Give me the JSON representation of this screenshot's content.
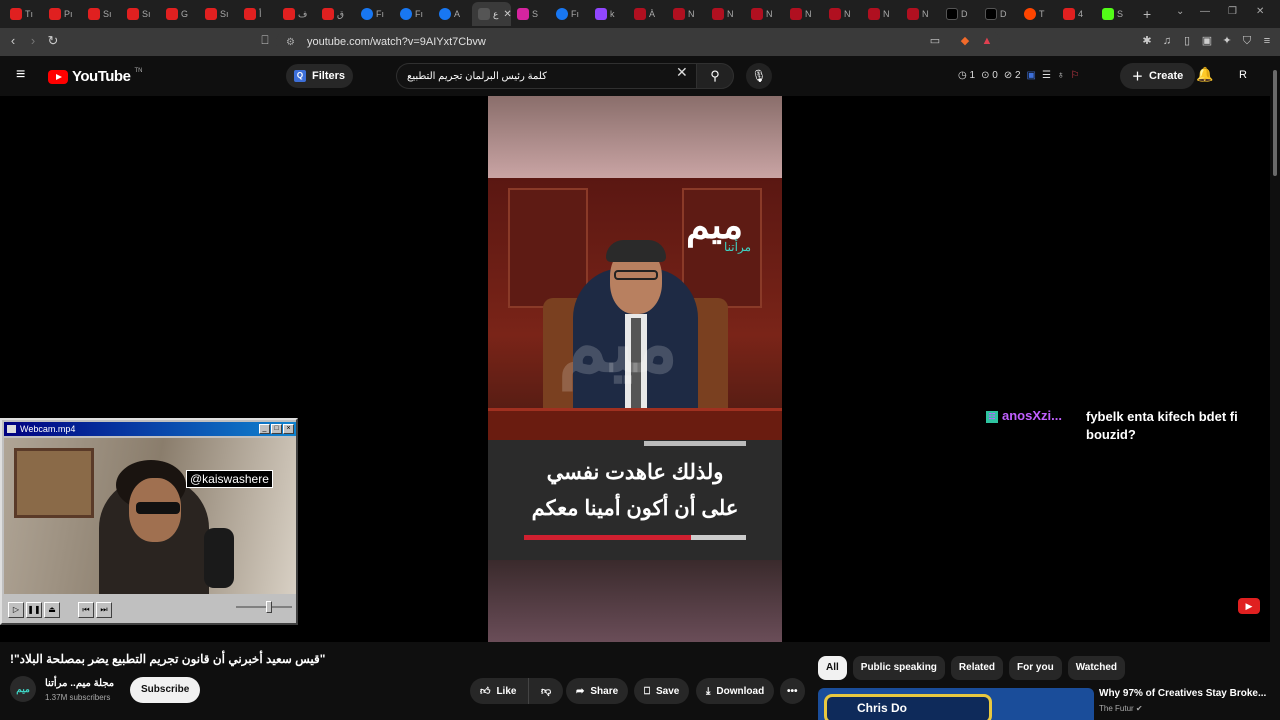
{
  "browser": {
    "tabs": [
      {
        "icon": "yt",
        "label": "Tı"
      },
      {
        "icon": "yt",
        "label": "Pı"
      },
      {
        "icon": "yt",
        "label": "Sı"
      },
      {
        "icon": "yt",
        "label": "Sı"
      },
      {
        "icon": "yt",
        "label": "G"
      },
      {
        "icon": "yt",
        "label": "Sı"
      },
      {
        "icon": "yt",
        "label": "أ"
      },
      {
        "icon": "yt",
        "label": "ف"
      },
      {
        "icon": "yt",
        "label": "ق"
      },
      {
        "icon": "fb",
        "label": "Fı"
      },
      {
        "icon": "fb",
        "label": "Fı"
      },
      {
        "icon": "fb",
        "label": "A"
      },
      {
        "icon": "tk",
        "label": "ع",
        "active": true
      },
      {
        "icon": "ig",
        "label": "S"
      },
      {
        "icon": "fb",
        "label": "Fı"
      },
      {
        "icon": "tw",
        "label": "k"
      },
      {
        "icon": "n",
        "label": "À"
      },
      {
        "icon": "n",
        "label": "N"
      },
      {
        "icon": "n",
        "label": "N"
      },
      {
        "icon": "n",
        "label": "N"
      },
      {
        "icon": "n",
        "label": "N"
      },
      {
        "icon": "n",
        "label": "N"
      },
      {
        "icon": "n",
        "label": "N"
      },
      {
        "icon": "n",
        "label": "N"
      },
      {
        "icon": "x",
        "label": "D"
      },
      {
        "icon": "x",
        "label": "D"
      },
      {
        "icon": "rd",
        "label": "T"
      },
      {
        "icon": "yt",
        "label": "4"
      },
      {
        "icon": "kk",
        "label": "S"
      }
    ],
    "url": "youtube.com/watch?v=9AIYxt7Cbvw"
  },
  "youtube": {
    "logo_text": "YouTube",
    "logo_sup": "TN",
    "filters_label": "Filters",
    "search_query": "كلمة رئيس البرلمان تجريم التطبيع",
    "stats": {
      "a": "1",
      "b": "0",
      "c": "2"
    },
    "create_label": "Create",
    "avatar_letter": "R"
  },
  "video": {
    "brand_text": "ميم",
    "brand_sub": "مرأتنا",
    "subtitle_line1": "ولذلك عاهدت نفسي",
    "subtitle_line2": "على أن أكون أمينا معكم",
    "progress": 0.75
  },
  "chat": {
    "username": "anosXzi...",
    "message": "fybelk enta kifech bdet fi bouzid?"
  },
  "webcam": {
    "title": "Webcam.mp4",
    "handle": "@kaiswashere"
  },
  "details": {
    "title": "\"قيس سعيد أخبرني أن قانون تجريم التطبيع يضر بمصلحة البلاد\"!",
    "channel_avatar": "ميم",
    "channel_name": "مجلة ميم.. مرأتنا",
    "subscribers": "1.37M subscribers",
    "subscribe_label": "Subscribe",
    "like_label": "Like",
    "share_label": "Share",
    "save_label": "Save",
    "download_label": "Download"
  },
  "sidebar": {
    "chips": [
      "All",
      "Public speaking",
      "Related",
      "For you",
      "Watched"
    ],
    "rec_title": "Why 97% of Creatives Stay Broke...",
    "rec_channel": "The Futur",
    "rec_thumb_text": "Chris Do"
  }
}
